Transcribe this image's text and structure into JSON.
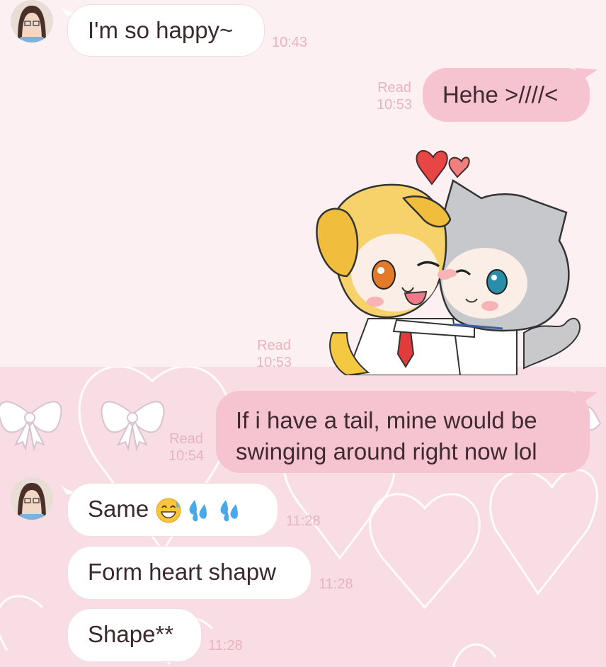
{
  "theme": {
    "accent": "#f6c4d0",
    "background": "#fdf0f2",
    "meta_color": "#e9b3be"
  },
  "messages": {
    "m1": {
      "text": "I'm so happy~",
      "time": "10:43"
    },
    "m2": {
      "text": "Hehe >////<",
      "read": "Read",
      "time": "10:53"
    },
    "m3": {
      "sticker": "dog-and-cat-hug-sticker",
      "read": "Read",
      "time": "10:53"
    },
    "m4": {
      "line1": "If i have a tail, mine would be",
      "line2": "swinging around right now lol",
      "read": "Read",
      "time": "10:54"
    },
    "m5": {
      "text": "Same",
      "emojis": [
        "sweat-smile-emoji",
        "sweat-droplets-emoji",
        "sweat-droplets-emoji"
      ],
      "time": "11:28"
    },
    "m6": {
      "text": "Form heart shapw",
      "time": "11:28"
    },
    "m7": {
      "text": "Shape**",
      "time": "11:28"
    }
  }
}
